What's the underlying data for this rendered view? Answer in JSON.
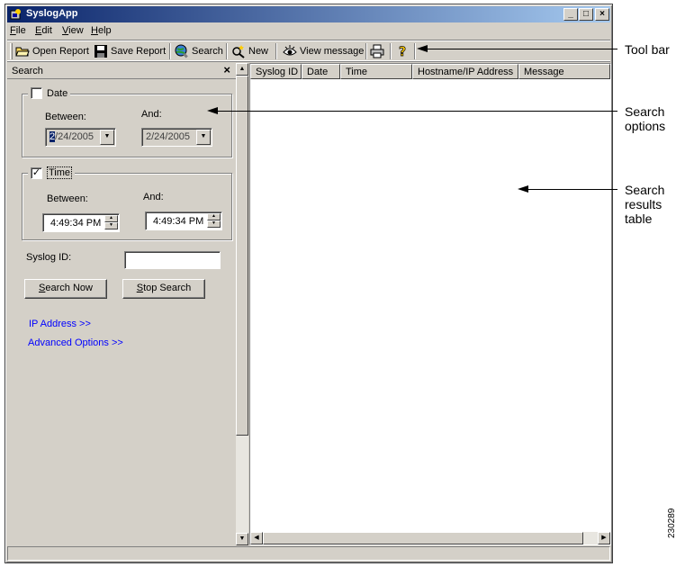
{
  "window": {
    "title": "SyslogApp",
    "controls": [
      "_",
      "□",
      "×"
    ]
  },
  "menubar": {
    "items": [
      {
        "label": "File",
        "accel": "F",
        "rest": "ile"
      },
      {
        "label": "Edit",
        "accel": "E",
        "rest": "dit"
      },
      {
        "label": "View",
        "accel": "V",
        "rest": "iew"
      },
      {
        "label": "Help",
        "accel": "H",
        "rest": "elp"
      }
    ]
  },
  "toolbar": {
    "open_report": "Open Report",
    "save_report": "Save Report",
    "search": "Search",
    "new": "New",
    "view_message": "View message"
  },
  "search_pane": {
    "title": "Search",
    "close": "×",
    "date": {
      "label": "Date",
      "checked": false,
      "between_label": "Between:",
      "and_label": "And:",
      "from_highlight": "2",
      "from_rest": "/24/2005",
      "to_value": "2/24/2005"
    },
    "time": {
      "label": "Time",
      "checked": true,
      "check_mark": "✓",
      "between_label": "Between:",
      "and_label": "And:",
      "from_value": "4:49:34 PM",
      "to_value": "4:49:34 PM"
    },
    "syslog_id_label": "Syslog ID:",
    "syslog_id_value": "",
    "search_now": {
      "accel": "S",
      "rest": "earch Now"
    },
    "stop_search": {
      "accel": "S",
      "rest": "top Search"
    },
    "ip_address_link": "IP Address >>",
    "advanced_options_link": "Advanced Options  >>"
  },
  "results_table": {
    "columns": [
      "Syslog ID",
      "Date",
      "Time",
      "Hostname/IP Address",
      "Message"
    ],
    "rows": []
  },
  "callouts": {
    "toolbar": "Tool bar",
    "search_options_1": "Search",
    "search_options_2": "options",
    "results_1": "Search",
    "results_2": "results",
    "results_3": "table"
  },
  "figure_id": "230289"
}
